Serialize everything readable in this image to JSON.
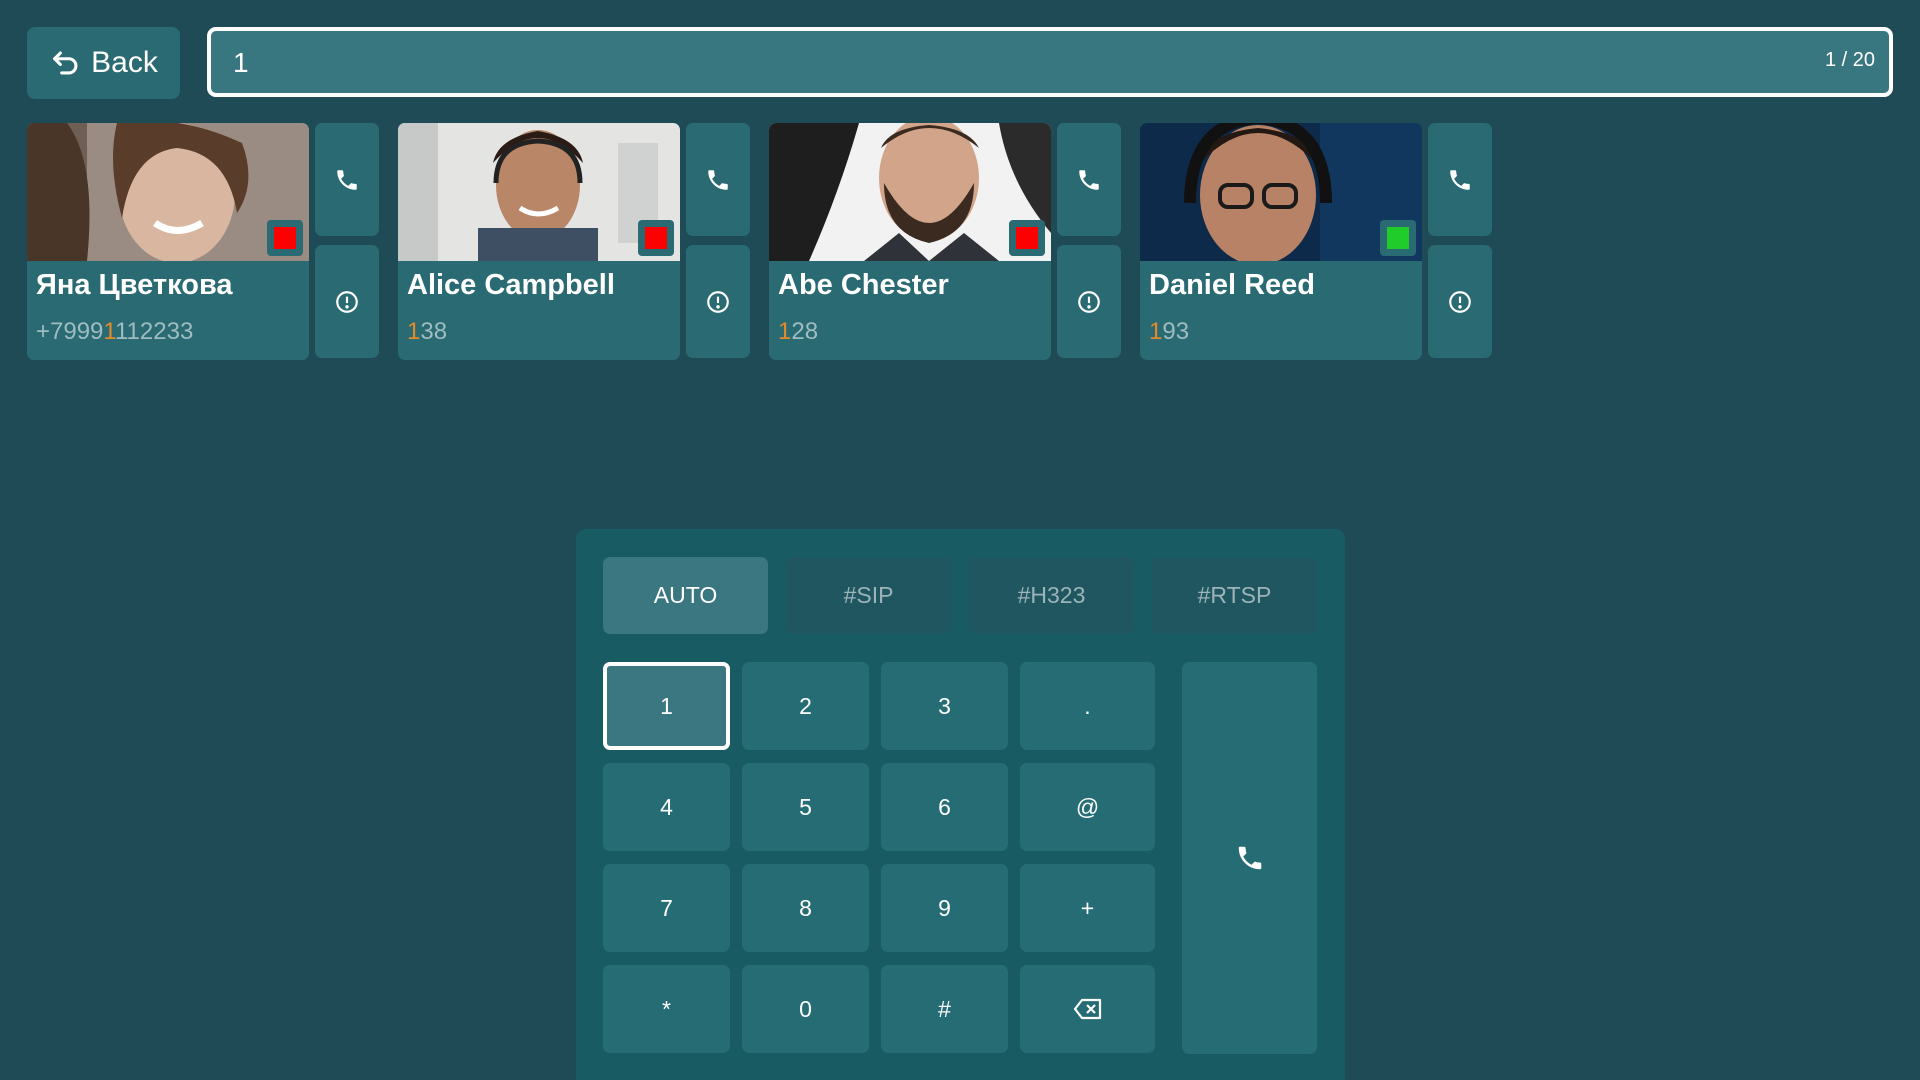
{
  "header": {
    "back_label": "Back",
    "search_value": "1",
    "result_counter": "1 / 20"
  },
  "contacts": [
    {
      "name": "Яна Цветкова",
      "number_prefix": "+7999",
      "number_match": "1",
      "number_suffix": "112233",
      "status": "busy",
      "status_color": "#ff0000"
    },
    {
      "name": "Alice Campbell",
      "number_prefix": "",
      "number_match": "1",
      "number_suffix": "38",
      "status": "busy",
      "status_color": "#ff0000"
    },
    {
      "name": "Abe Chester",
      "number_prefix": "",
      "number_match": "1",
      "number_suffix": "28",
      "status": "busy",
      "status_color": "#ff0000"
    },
    {
      "name": "Daniel Reed",
      "number_prefix": "",
      "number_match": "1",
      "number_suffix": "93",
      "status": "available",
      "status_color": "#1fcc2a"
    }
  ],
  "protocols": {
    "items": [
      "AUTO",
      "#SIP",
      "#H323",
      "#RTSP"
    ],
    "selected": "AUTO"
  },
  "keypad": {
    "keys": [
      "1",
      "2",
      "3",
      ".",
      "4",
      "5",
      "6",
      "@",
      "7",
      "8",
      "9",
      "+",
      "*",
      "0",
      "#"
    ],
    "backspace_icon": "backspace-icon",
    "selected_key": "1"
  },
  "icons": {
    "back": "undo-arrow-icon",
    "call": "phone-icon",
    "info": "info-circle-icon"
  },
  "colors": {
    "background": "#1f4b57",
    "highlight": "#e38a2a",
    "busy": "#ff0000",
    "available": "#1fcc2a"
  }
}
